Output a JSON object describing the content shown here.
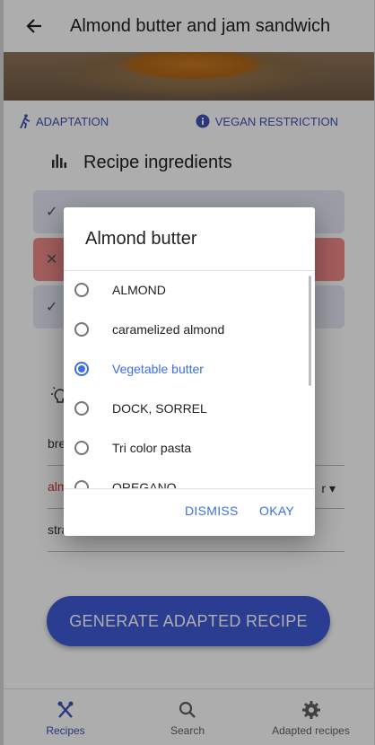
{
  "app_bar": {
    "title": "Almond butter and jam sandwich",
    "back_icon": "arrow-left-icon"
  },
  "tabs": [
    {
      "label": "ADAPTATION",
      "icon": "walking-person-icon"
    },
    {
      "label": "VEGAN RESTRICTION",
      "icon": "info-icon"
    }
  ],
  "section": {
    "title": "Recipe ingredients",
    "icon": "bar-chart-icon"
  },
  "background_fields": [
    {
      "value": "bre"
    },
    {
      "value": "alm"
    },
    {
      "value": "stra"
    }
  ],
  "generate_button": {
    "label": "GENERATE ADAPTED RECIPE"
  },
  "bottom_nav": [
    {
      "label": "Recipes",
      "icon": "fork-knife-icon"
    },
    {
      "label": "Search",
      "icon": "search-icon"
    },
    {
      "label": "Adapted recipes",
      "icon": "gear-icon"
    }
  ],
  "dialog": {
    "title": "Almond butter",
    "options": [
      {
        "label": "ALMOND"
      },
      {
        "label": "caramelized almond"
      },
      {
        "label": "Vegetable butter"
      },
      {
        "label": "DOCK, SORREL"
      },
      {
        "label": "Tri color pasta"
      },
      {
        "label": "OREGANO"
      }
    ],
    "selected": "Vegetable butter",
    "dismiss_label": "DISMISS",
    "okay_label": "OKAY"
  },
  "colors": {
    "accent": "#3f6ee0",
    "primary": "#3f51b5",
    "error_row": "#f08a8a"
  }
}
